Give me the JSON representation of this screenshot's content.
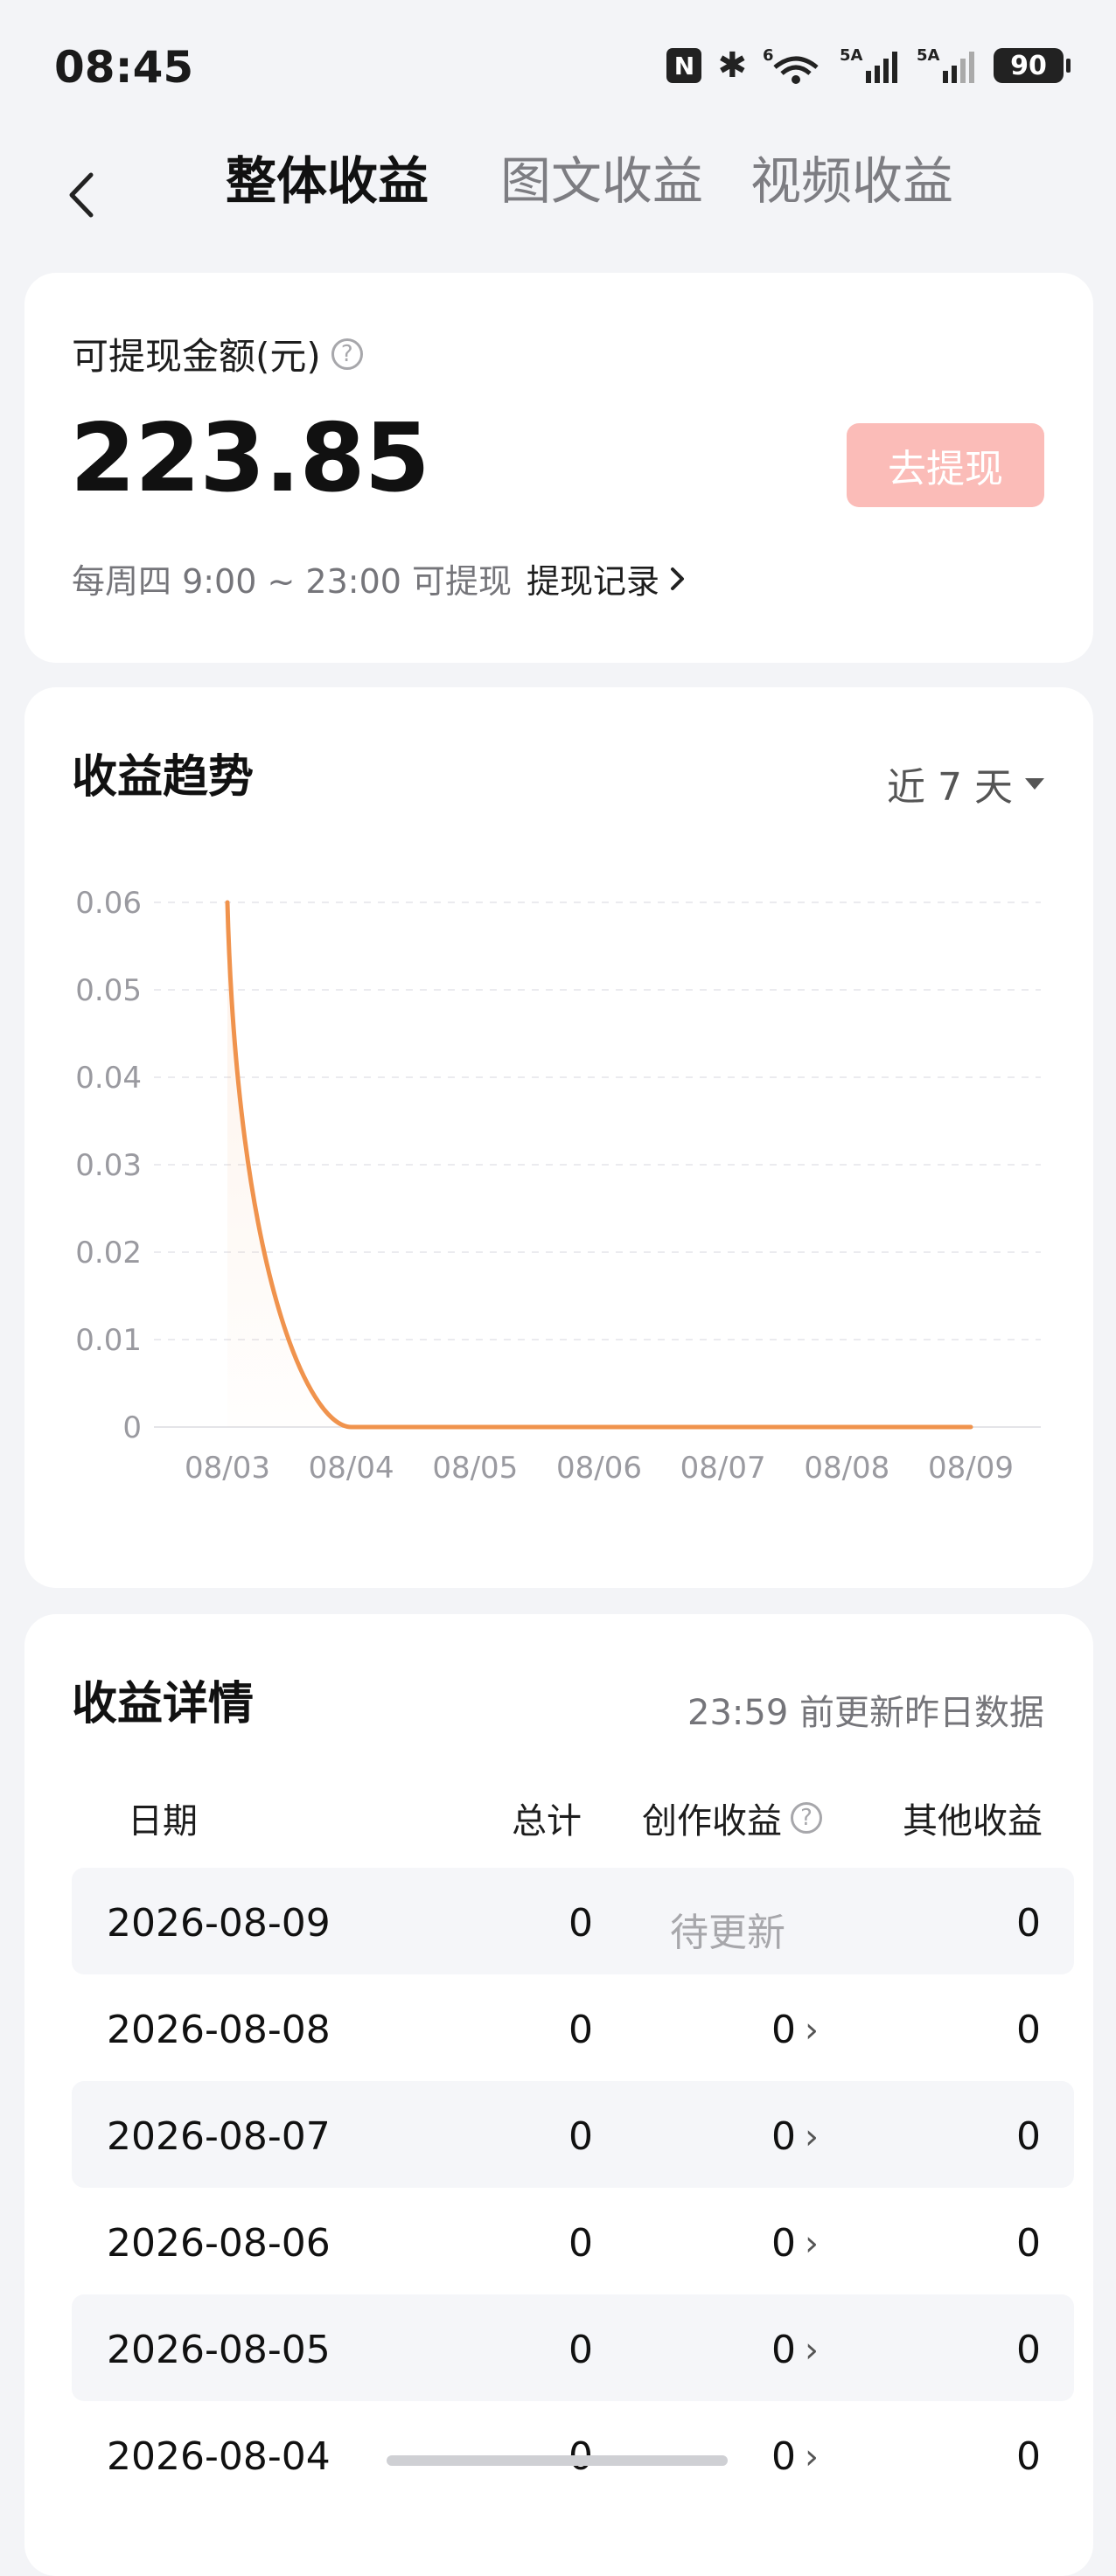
{
  "status_bar": {
    "time": "08:45",
    "battery": "90",
    "signal_label": "5A",
    "wifi_label": "6"
  },
  "tabs": [
    {
      "label": "整体收益",
      "active": true
    },
    {
      "label": "图文收益",
      "active": false
    },
    {
      "label": "视频收益",
      "active": false
    }
  ],
  "balance": {
    "label": "可提现金额(元)",
    "amount": "223.85",
    "withdraw_button": "去提现",
    "note": "每周四 9:00 ~ 23:00 可提现",
    "record_link": "提现记录"
  },
  "trend": {
    "title": "收益趋势",
    "range": "近 7 天"
  },
  "chart_data": {
    "type": "line",
    "x": [
      "08/03",
      "08/04",
      "08/05",
      "08/06",
      "08/07",
      "08/08",
      "08/09"
    ],
    "series": [
      {
        "values": [
          0.06,
          0,
          0,
          0,
          0,
          0,
          0
        ]
      }
    ],
    "yticks": [
      "0",
      "0.01",
      "0.02",
      "0.03",
      "0.04",
      "0.05",
      "0.06"
    ],
    "ylim": [
      0,
      0.06
    ],
    "grid": true,
    "color": "#f0934d"
  },
  "details": {
    "title": "收益详情",
    "update_note": "23:59 前更新昨日数据",
    "columns": {
      "date": "日期",
      "total": "总计",
      "creation": "创作收益",
      "other": "其他收益"
    },
    "rows": [
      {
        "date": "2026-08-09",
        "total": "0",
        "creation": "待更新",
        "other": "0"
      },
      {
        "date": "2026-08-08",
        "total": "0",
        "creation": "0",
        "other": "0"
      },
      {
        "date": "2026-08-07",
        "total": "0",
        "creation": "0",
        "other": "0"
      },
      {
        "date": "2026-08-06",
        "total": "0",
        "creation": "0",
        "other": "0"
      },
      {
        "date": "2026-08-05",
        "total": "0",
        "creation": "0",
        "other": "0"
      },
      {
        "date": "2026-08-04",
        "total": "0",
        "creation": "0",
        "other": "0"
      }
    ]
  }
}
